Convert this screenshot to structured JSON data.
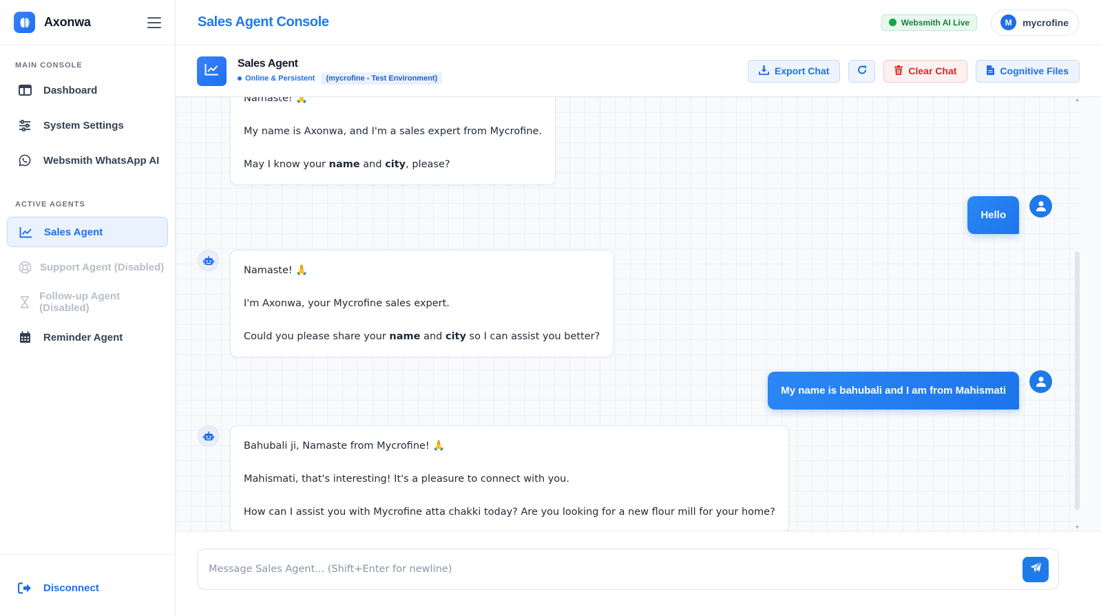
{
  "brand": {
    "name": "Axonwa"
  },
  "sidebar": {
    "main_section_title": "MAIN CONSOLE",
    "main_items": [
      {
        "label": "Dashboard",
        "icon": "dashboard-icon"
      },
      {
        "label": "System Settings",
        "icon": "sliders-icon"
      },
      {
        "label": "Websmith WhatsApp AI",
        "icon": "whatsapp-icon"
      }
    ],
    "agents_section_title": "ACTIVE AGENTS",
    "agent_items": [
      {
        "label": "Sales Agent",
        "icon": "chart-line-icon",
        "state": "active"
      },
      {
        "label": "Support Agent (Disabled)",
        "icon": "lifebuoy-icon",
        "state": "disabled"
      },
      {
        "label": "Follow-up Agent (Disabled)",
        "icon": "hourglass-icon",
        "state": "disabled"
      },
      {
        "label": "Reminder Agent",
        "icon": "calendar-icon",
        "state": "normal"
      }
    ],
    "disconnect_label": "Disconnect"
  },
  "topbar": {
    "title": "Sales Agent Console",
    "live_badge": "Websmith AI Live",
    "user_initial": "M",
    "user_name": "mycrofine"
  },
  "agent_header": {
    "name": "Sales Agent",
    "status": "Online & Persistent",
    "environment": "(mycrofine - Test Environment)",
    "buttons": {
      "export": "Export Chat",
      "clear": "Clear Chat",
      "files": "Cognitive Files"
    }
  },
  "chat": {
    "messages": [
      {
        "role": "bot",
        "lines": [
          "Namaste! 🙏",
          "My name is Axonwa, and I'm a sales expert from Mycrofine.",
          "May I know your <b>name</b> and <b>city</b>, please?"
        ]
      },
      {
        "role": "user",
        "text": "Hello"
      },
      {
        "role": "bot",
        "lines": [
          "Namaste! 🙏",
          "I'm Axonwa, your Mycrofine sales expert.",
          "Could you please share your <b>name</b> and <b>city</b> so I can assist you better?"
        ]
      },
      {
        "role": "user",
        "text": "My name is bahubali and I am from Mahismati"
      },
      {
        "role": "bot",
        "lines": [
          "Bahubali ji, Namaste from Mycrofine! 🙏",
          "Mahismati, that's interesting! It's a pleasure to connect with you.",
          "How can I assist you with Mycrofine atta chakki today? Are you looking for a new flour mill for your home?"
        ]
      }
    ]
  },
  "composer": {
    "placeholder": "Message Sales Agent... (Shift+Enter for newline)",
    "value": ""
  },
  "colors": {
    "accent": "#1f7ae8",
    "live_green": "#16a34a",
    "danger": "#dc2626"
  }
}
